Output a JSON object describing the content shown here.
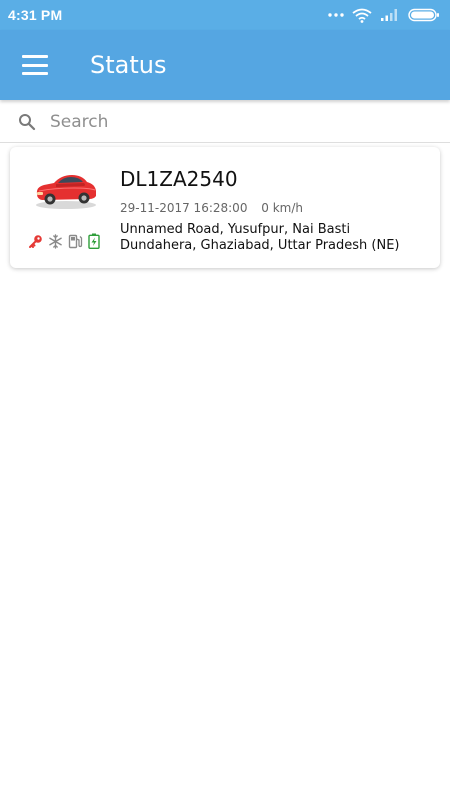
{
  "status_bar": {
    "time": "4:31 PM",
    "icons": [
      "more-dots-icon",
      "wifi-icon",
      "signal-icon",
      "battery-icon"
    ]
  },
  "app_bar": {
    "title": "Status",
    "menu_icon": "hamburger-menu-icon"
  },
  "search": {
    "placeholder": "Search",
    "value": "",
    "icon": "search-icon"
  },
  "vehicles": [
    {
      "plate": "DL1ZA2540",
      "timestamp": "29-11-2017 16:28:00",
      "speed": "0 km/h",
      "address": "Unnamed Road, Yusufpur, Nai Basti Dundahera, Ghaziabad, Uttar Pradesh (NE)",
      "status_icons": [
        "ignition-key-icon",
        "ac-snowflake-icon",
        "fuel-pump-icon",
        "battery-charging-icon"
      ]
    }
  ],
  "colors": {
    "status_bar": "#5aaee6",
    "app_bar": "#55a6e2",
    "ignition": "#e53935",
    "battery": "#2e9e3a",
    "inactive_icon": "#8a8a8a"
  }
}
